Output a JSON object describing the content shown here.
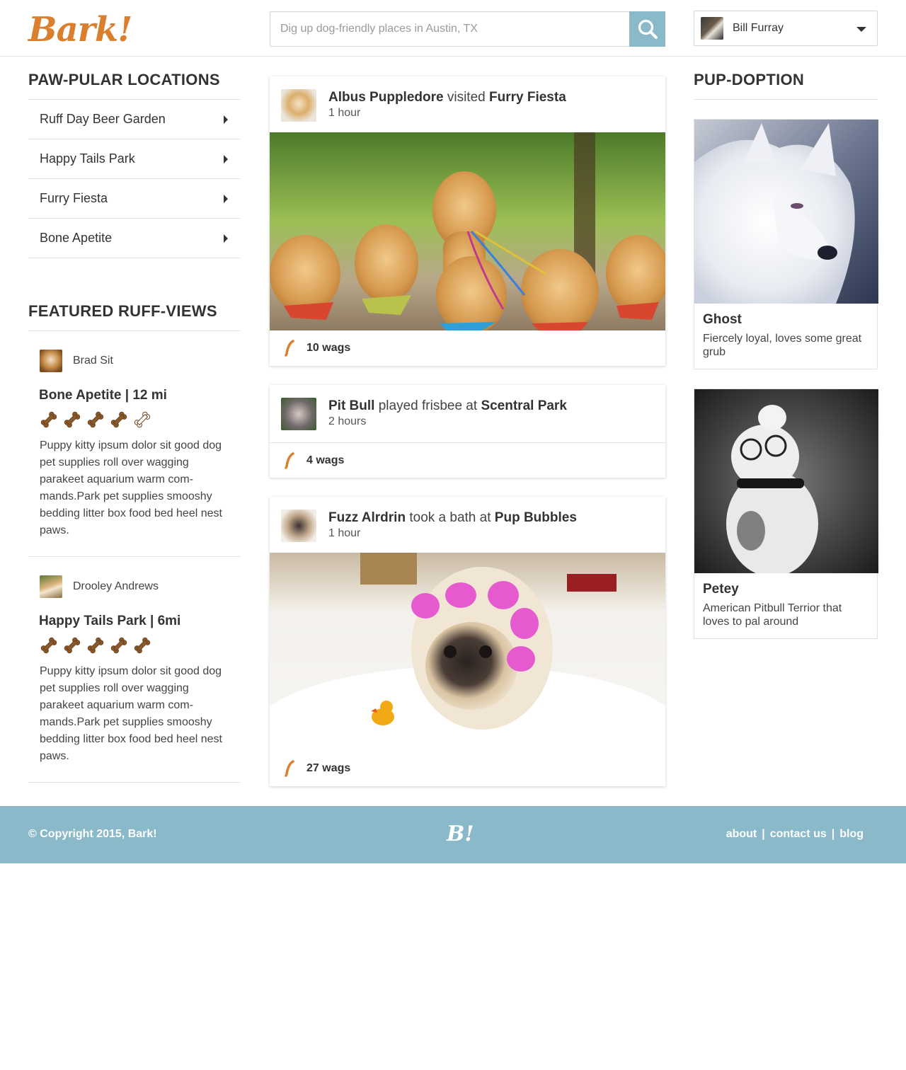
{
  "header": {
    "logo_text": "Bark!",
    "search_placeholder": "Dig up dog-friendly places in Austin, TX",
    "user_name": "Bill Furray"
  },
  "colors": {
    "accent": "#d97f2e",
    "footer_bg": "#8ab9c9",
    "search_button": "#8ab9c9"
  },
  "locations": {
    "title": "PAW-PULAR LOCATIONS",
    "items": [
      {
        "label": "Ruff Day Beer Garden"
      },
      {
        "label": "Happy Tails Park"
      },
      {
        "label": "Furry Fiesta"
      },
      {
        "label": "Bone Apetite"
      }
    ]
  },
  "reviews": {
    "title": "FEATURED RUFF-VIEWS",
    "items": [
      {
        "reviewer": "Brad Sit",
        "place": "Bone Apetite | 12 mi",
        "rating": 4,
        "max_rating": 5,
        "text": "Puppy kitty ipsum dolor sit good dog pet supplies roll over wagging parakeet aquarium warm com-mands.Park pet supplies smooshy bedding litter box food bed heel nest paws."
      },
      {
        "reviewer": "Drooley Andrews",
        "place": "Happy Tails Park | 6mi",
        "rating": 5,
        "max_rating": 5,
        "text": "Puppy kitty ipsum dolor sit good dog pet supplies roll over wagging parakeet aquarium warm com-mands.Park pet supplies smooshy bedding litter box food bed heel nest paws."
      }
    ]
  },
  "feed": [
    {
      "actor": "Albus Puppledore",
      "verb": "visited",
      "place": "Furry Fiesta",
      "time": "1 hour",
      "wags": "10 wags"
    },
    {
      "actor": "Pit Bull",
      "verb": "played frisbee at",
      "place": "Scentral Park",
      "time": "2 hours",
      "wags": "4 wags"
    },
    {
      "actor": "Fuzz Alrdrin",
      "verb": "took a bath at",
      "place": "Pup Bubbles",
      "time": "1 hour",
      "wags": "27 wags"
    }
  ],
  "adoption": {
    "title": "PUP-DOPTION",
    "items": [
      {
        "name": "Ghost",
        "description": "Fiercely loyal, loves some great grub"
      },
      {
        "name": "Petey",
        "description": "American Pitbull Terrior that loves to pal around"
      }
    ]
  },
  "footer": {
    "copyright": "© Copyright 2015, Bark!",
    "logo_text": "B!",
    "links": [
      {
        "label": "about"
      },
      {
        "label": "contact us"
      },
      {
        "label": "blog"
      }
    ],
    "separator": "|"
  }
}
